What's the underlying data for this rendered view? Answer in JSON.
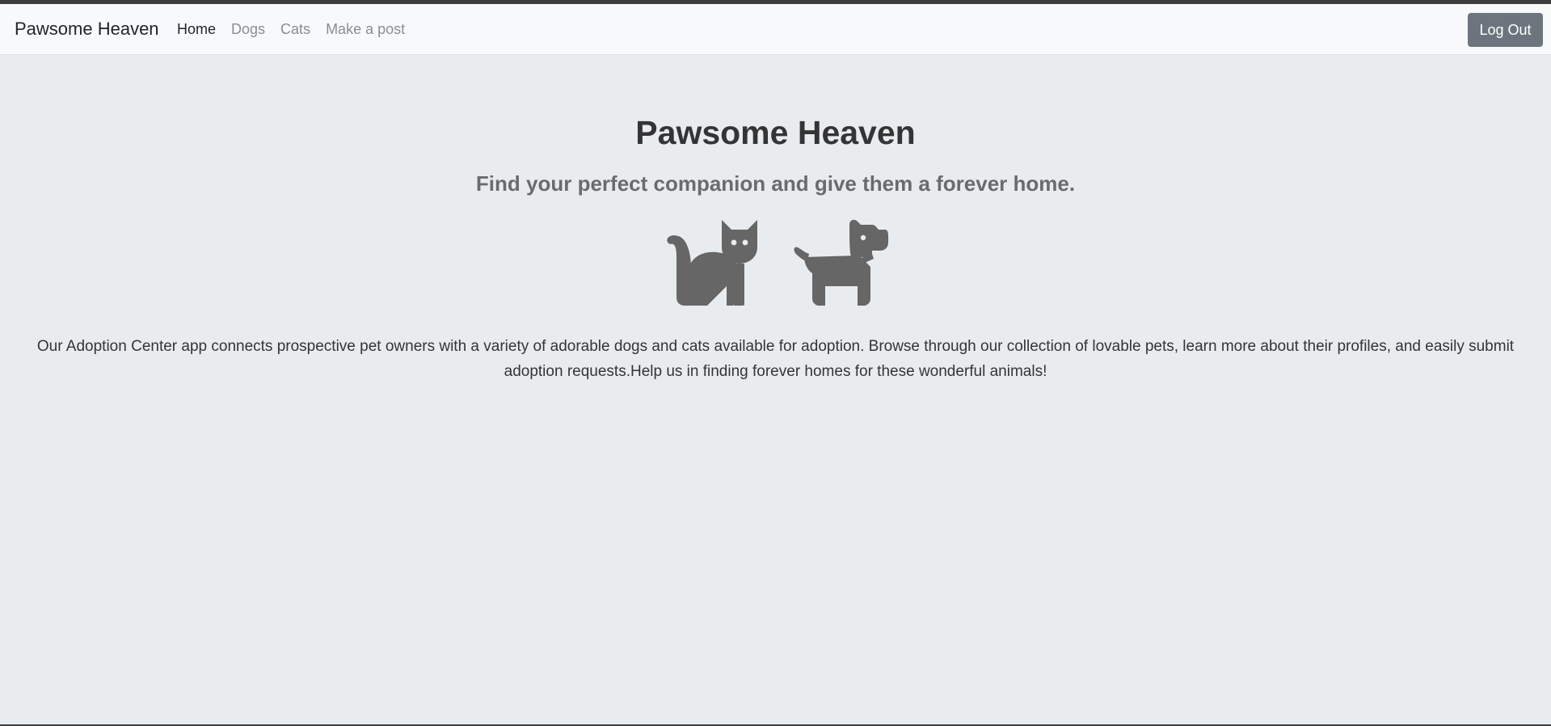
{
  "navbar": {
    "brand": "Pawsome Heaven",
    "links": [
      {
        "label": "Home",
        "active": true
      },
      {
        "label": "Dogs",
        "active": false
      },
      {
        "label": "Cats",
        "active": false
      },
      {
        "label": "Make a post",
        "active": false
      }
    ],
    "logout_label": "Log Out"
  },
  "hero": {
    "title": "Pawsome Heaven",
    "subtitle": "Find your perfect companion and give them a forever home.",
    "icons": [
      "cat-icon",
      "dog-icon"
    ],
    "description": "Our Adoption Center app connects prospective pet owners with a variety of adorable dogs and cats available for adoption. Browse through our collection of lovable pets, learn more about their profiles, and easily submit adoption requests.Help us in finding forever homes for these wonderful animals!"
  },
  "colors": {
    "page_background": "#e9ecef",
    "navbar_background": "#f8f9fa",
    "logout_button": "#6c757d",
    "icon_fill": "#666666"
  }
}
